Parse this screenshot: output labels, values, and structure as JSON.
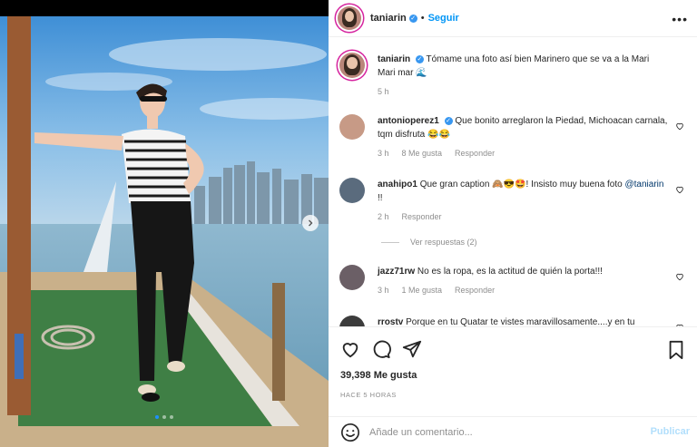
{
  "post": {
    "username": "taniarin",
    "verified_mark": "✓",
    "separator": "•",
    "follow_label": "Seguir",
    "more_label": "•••",
    "caption": "Tómame una foto así bien Marinero que se va a la Mari Mari mar 🌊",
    "caption_time": "5 h",
    "likes": "39,398 Me gusta",
    "time_ago": "HACE 5 HORAS",
    "carousel": {
      "slides": 3,
      "current": 1
    }
  },
  "comments": [
    {
      "user": "antonioperez1",
      "verified": true,
      "text": "Que bonito arreglaron la Piedad, Michoacan carnala, tqm disfruta 😂😂",
      "time": "3 h",
      "likes": "8 Me gusta",
      "reply": "Responder"
    },
    {
      "user": "anahipo1",
      "verified": false,
      "text": "Que gran caption 🙈😎🤩! Insisto muy buena foto",
      "mention": "@taniarin",
      "text_after": " !!",
      "time": "2 h",
      "likes": "",
      "reply": "Responder",
      "view_replies": "Ver respuestas (2)"
    },
    {
      "user": "jazz71rw",
      "verified": false,
      "text": "No es la ropa, es la actitud de quién la porta!!!",
      "time": "3 h",
      "likes": "1 Me gusta",
      "reply": "Responder"
    },
    {
      "user": "rrostv",
      "verified": false,
      "text": "Porque en tu Quatar te vistes maravillosamente....y en tu",
      "time": "",
      "likes": "",
      "reply": ""
    }
  ],
  "composer": {
    "placeholder": "Añade un comentario...",
    "publish_label": "Publicar"
  },
  "icons": {
    "like": "heart-icon",
    "comment": "comment-icon",
    "share": "share-icon",
    "save": "bookmark-icon",
    "emoji": "emoji-icon",
    "next": "chevron-right-icon"
  },
  "colors": {
    "accent": "#0095f6",
    "verified": "#3897f0",
    "active_dot": "#1e90ff"
  }
}
